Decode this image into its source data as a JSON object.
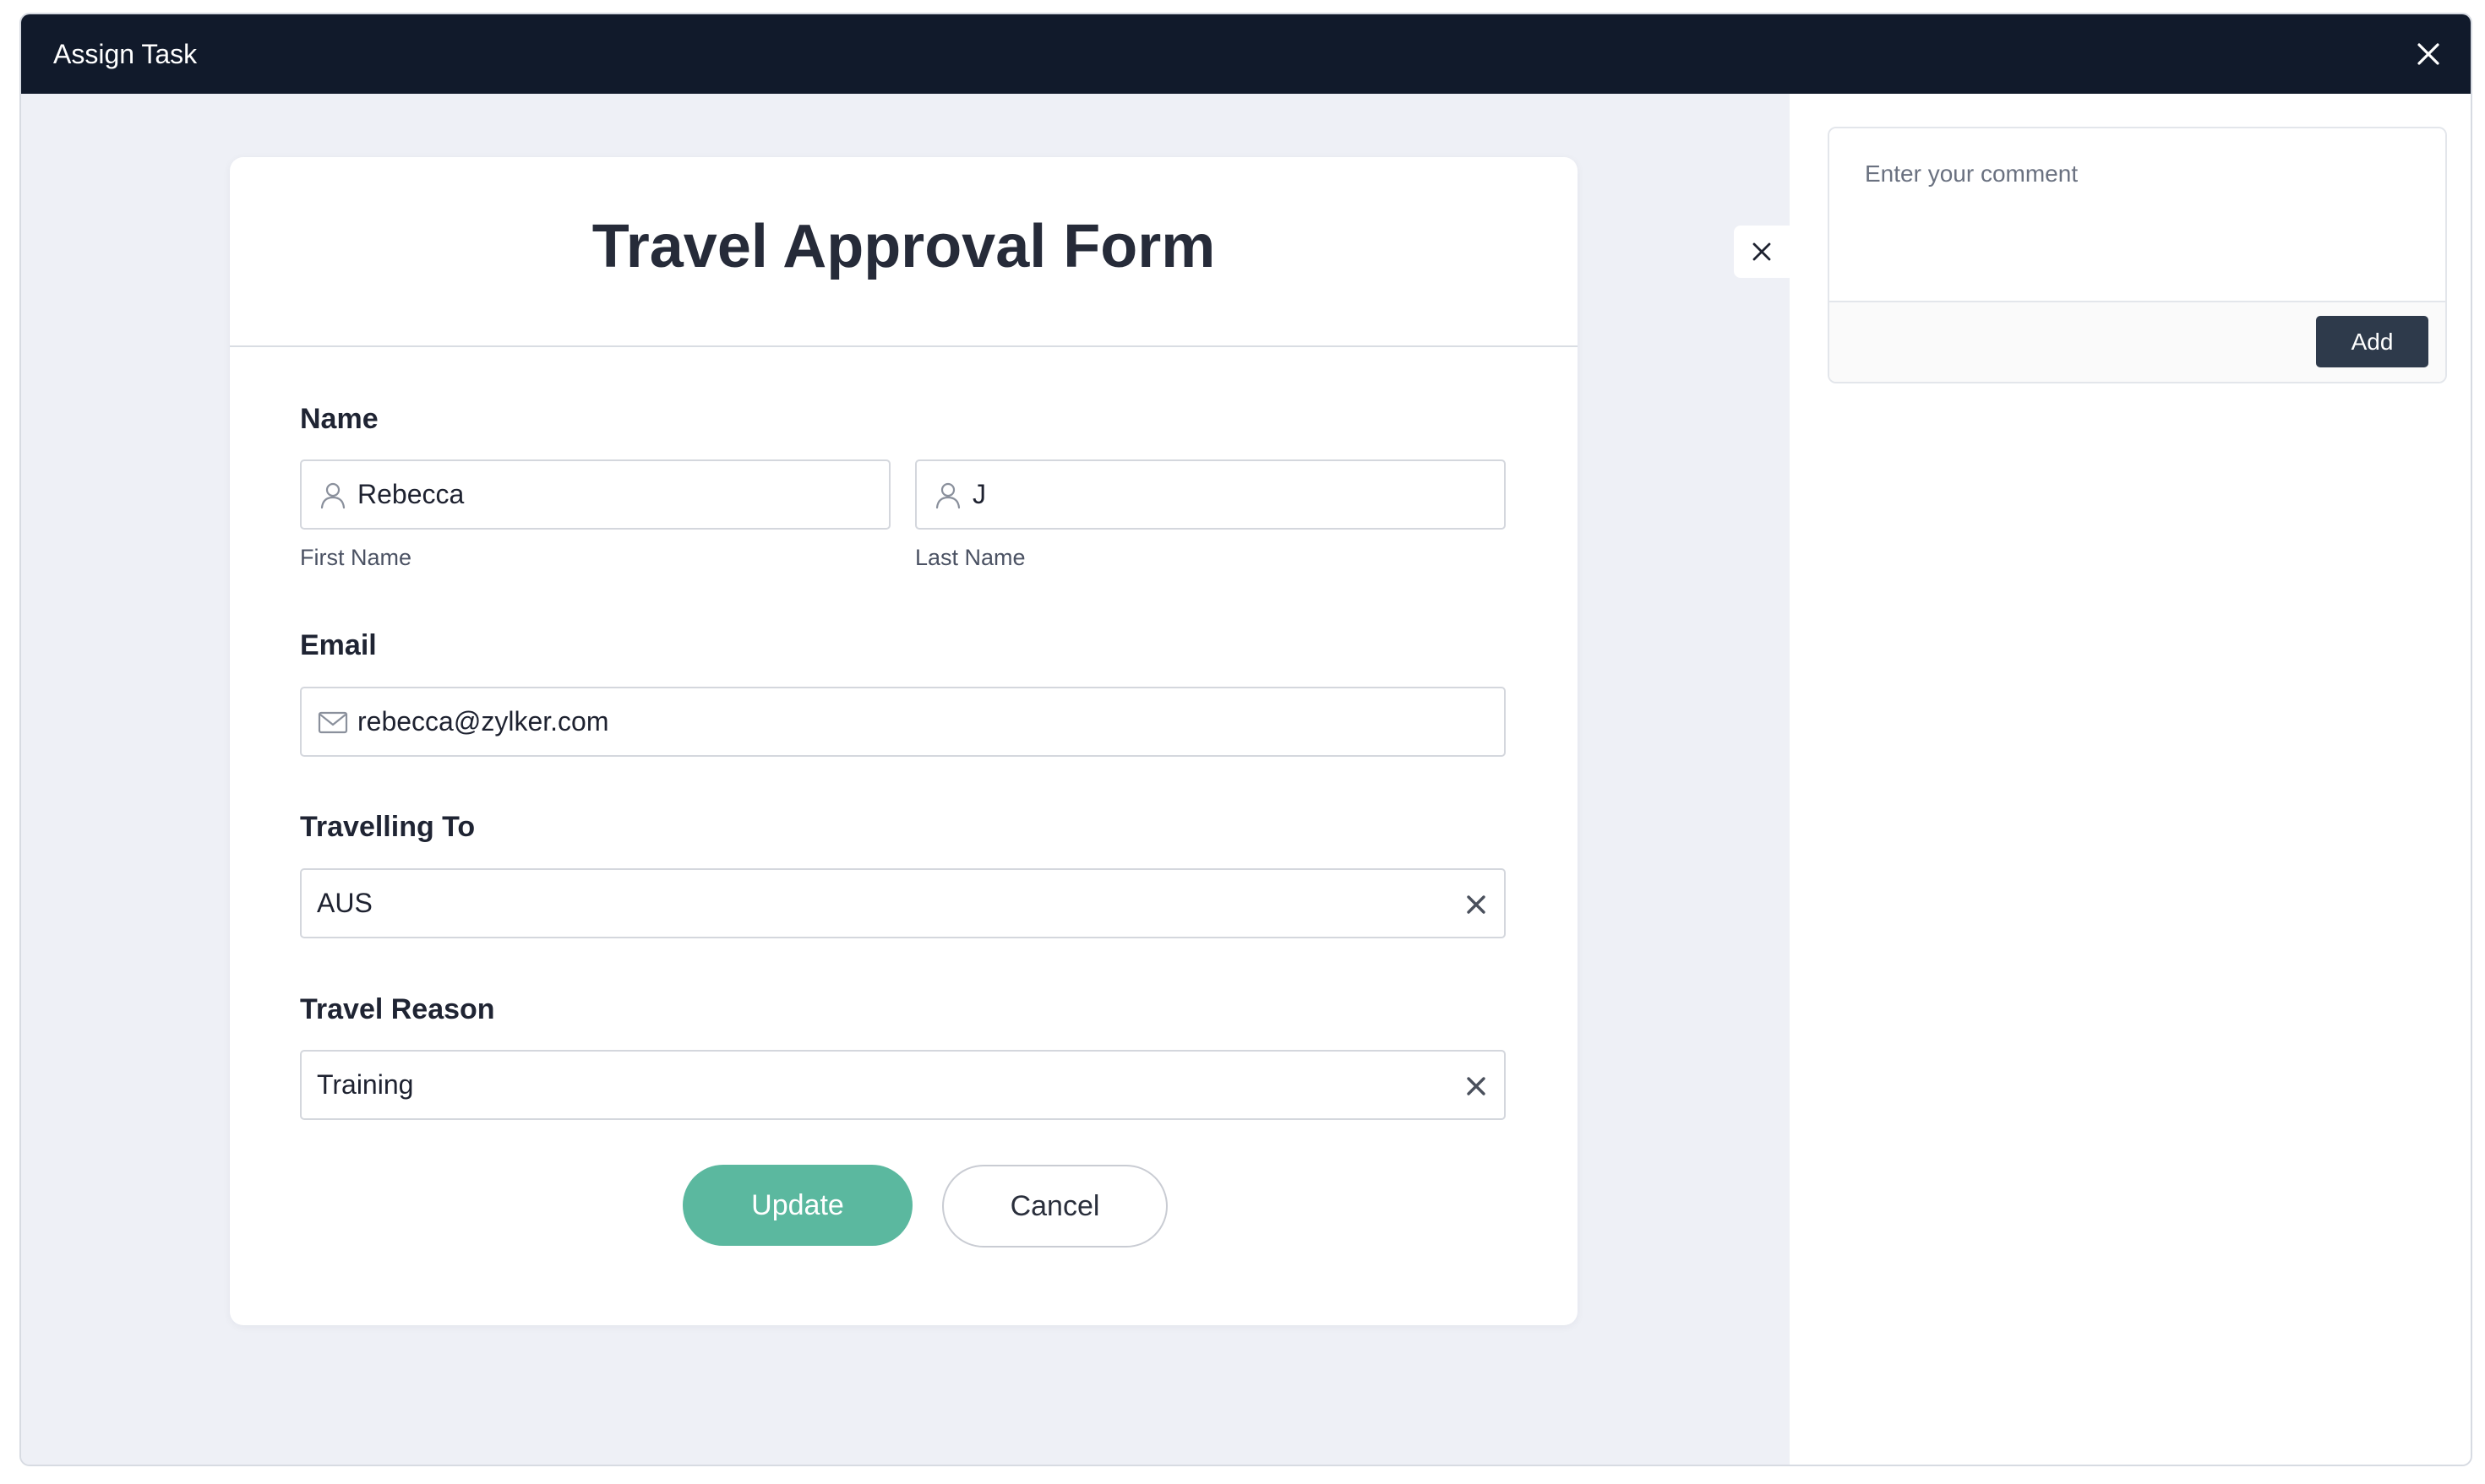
{
  "window": {
    "title": "Assign Task"
  },
  "form": {
    "title": "Travel Approval Form",
    "name": {
      "label": "Name",
      "first_name": {
        "value": "Rebecca",
        "sublabel": "First Name"
      },
      "last_name": {
        "value": "J",
        "sublabel": "Last Name"
      }
    },
    "email": {
      "label": "Email",
      "value": "rebecca@zylker.com"
    },
    "travelling_to": {
      "label": "Travelling To",
      "value": "AUS"
    },
    "travel_reason": {
      "label": "Travel Reason",
      "value": "Training"
    },
    "buttons": {
      "update": "Update",
      "cancel": "Cancel"
    }
  },
  "comments": {
    "placeholder": "Enter your comment",
    "add_label": "Add"
  },
  "colors": {
    "titlebar": "#111a2b",
    "accent": "#5bb89f",
    "add_button": "#2e3a4b",
    "canvas": "#eef0f6"
  },
  "icons": {
    "window_close": "close-icon",
    "first_name": "user-icon",
    "last_name": "user-icon",
    "email": "mail-icon",
    "clear": "clear-icon",
    "panel_close": "close-icon"
  }
}
